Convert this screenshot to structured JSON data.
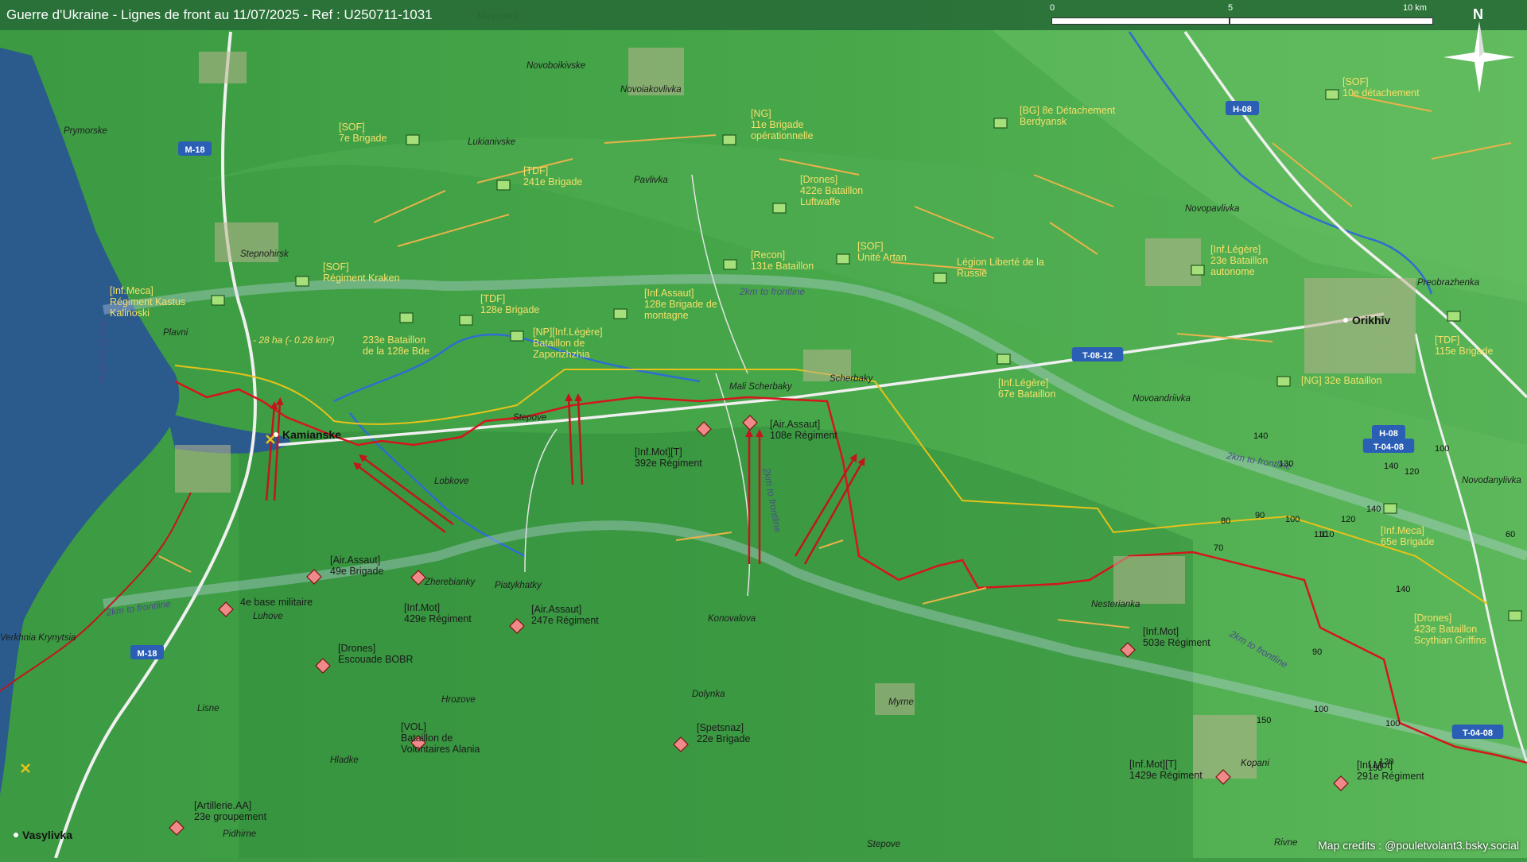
{
  "title": "Guerre d'Ukraine - Lignes de front au 11/07/2025 - Ref : U250711-1031",
  "scale": {
    "labels": [
      "0",
      "5",
      "10 km"
    ]
  },
  "compass": {
    "north": "N"
  },
  "credits": "Map credits : @pouletvolant3.bsky.social",
  "road_labels": [
    {
      "label": "M-18",
      "color": "#2a5fb5"
    },
    {
      "label": "M-18",
      "color": "#2a5fb5"
    },
    {
      "label": "H-08",
      "color": "#2a5fb5"
    },
    {
      "label": "T-08-12",
      "color": "#2a5fb5"
    },
    {
      "label": "H-08",
      "color": "#2a5fb5"
    },
    {
      "label": "T-04-08",
      "color": "#2a5fb5"
    },
    {
      "label": "T-04-08",
      "color": "#2a5fb5"
    }
  ],
  "places": [
    "Novoboikivske",
    "Novoiakovlivka",
    "Prymorske",
    "Lukianivske",
    "Pavlivka",
    "Stepnohirsk",
    "Plavni",
    "Stepove",
    "Mali Scherbaky",
    "Scherbaky",
    "Lobkove",
    "Piatykhatky",
    "Zherebianky",
    "Luhove",
    "Verkhnia Krynytsia",
    "Konovalova",
    "Hrozove",
    "Dolynka",
    "Myrne",
    "Lisne",
    "Hladke",
    "Pidhirne",
    "Novopavlivka",
    "Preobrazhenka",
    "Novoandriivka",
    "Novodanylivka",
    "Nesterianka",
    "Kopani",
    "Rivne",
    "Stepove",
    "Malynivka"
  ],
  "towns": [
    "Kamianske",
    "Orikhiv",
    "Vasylivka"
  ],
  "ukrainian_units": [
    {
      "line1": "[SOF]",
      "line2": "7e Brigade",
      "line3": ""
    },
    {
      "line1": "[TDF]",
      "line2": "241e Brigade",
      "line3": ""
    },
    {
      "line1": "[NG]",
      "line2": "11e Brigade",
      "line3": "opérationnelle"
    },
    {
      "line1": "[BG] 8e Détachement",
      "line2": "Berdyansk",
      "line3": ""
    },
    {
      "line1": "[SOF]",
      "line2": "10e détachement",
      "line3": ""
    },
    {
      "line1": "[Drones]",
      "line2": "422e Bataillon",
      "line3": "Luftwaffe"
    },
    {
      "line1": "[SOF]",
      "line2": "Régiment Kraken",
      "line3": ""
    },
    {
      "line1": "[Recon]",
      "line2": "131e Bataillon",
      "line3": ""
    },
    {
      "line1": "[SOF]",
      "line2": "Unité Artan",
      "line3": ""
    },
    {
      "line1": "Légion Liberté de la",
      "line2": "Russie",
      "line3": ""
    },
    {
      "line1": "[Inf.Meca]",
      "line2": "Régiment Kastus",
      "line3": "Kalinoski"
    },
    {
      "line1": "[TDF]",
      "line2": "128e Brigade",
      "line3": ""
    },
    {
      "line1": "[Inf.Assaut]",
      "line2": "128e Brigade de",
      "line3": "montagne"
    },
    {
      "line1": "233e Bataillon",
      "line2": "de la 128e Bde",
      "line3": ""
    },
    {
      "line1": "[NP][Inf.Légère]",
      "line2": "Bataillon de",
      "line3": "Zaporizhzhia"
    },
    {
      "line1": "[Inf.Légère]",
      "line2": "23e Bataillon",
      "line3": "autonome"
    },
    {
      "line1": "[TDF]",
      "line2": "115e Brigade",
      "line3": ""
    },
    {
      "line1": "[NG] 32e Bataillon",
      "line2": "",
      "line3": ""
    },
    {
      "line1": "[Inf.Légère]",
      "line2": "67e Bataillon",
      "line3": ""
    },
    {
      "line1": "[Inf.Meca]",
      "line2": "65e Brigade",
      "line3": ""
    },
    {
      "line1": "[Drones]",
      "line2": "423e Bataillon",
      "line3": "Scythian Griffins"
    }
  ],
  "russian_units": [
    {
      "line1": "[Air.Assaut]",
      "line2": "108e Régiment",
      "line3": ""
    },
    {
      "line1": "[Inf.Mot][T]",
      "line2": "392e Régiment",
      "line3": ""
    },
    {
      "line1": "[Air.Assaut]",
      "line2": "49e Brigade",
      "line3": ""
    },
    {
      "line1": "4e base militaire",
      "line2": "",
      "line3": ""
    },
    {
      "line1": "[Inf.Mot]",
      "line2": "429e Régiment",
      "line3": ""
    },
    {
      "line1": "[Air.Assaut]",
      "line2": "247e Régiment",
      "line3": ""
    },
    {
      "line1": "[Drones]",
      "line2": "Escouade BOBR",
      "line3": ""
    },
    {
      "line1": "[Inf.Mot]",
      "line2": "503e Régiment",
      "line3": ""
    },
    {
      "line1": "[VOL]",
      "line2": "Bataillon de",
      "line3": "Volontaires Alania"
    },
    {
      "line1": "[Spetsnaz]",
      "line2": "22e Brigade",
      "line3": ""
    },
    {
      "line1": "[Artillerie.AA]",
      "line2": "23e groupement",
      "line3": ""
    },
    {
      "line1": "[Inf.Mot][T]",
      "line2": "1429e Régiment",
      "line3": ""
    },
    {
      "line1": "[Inf.Mot]",
      "line2": "291e Régiment",
      "line3": ""
    }
  ],
  "notes": [
    "- 28 ha (- 0.28 km²)"
  ],
  "frontline_labels": [
    "2km to frontline",
    "2km to frontline",
    "2km to frontline",
    "2km to frontline",
    "2km to frontline",
    "2km to frontline"
  ],
  "elevations": [
    "130",
    "100",
    "120",
    "90",
    "100",
    "110",
    "120",
    "80",
    "110",
    "90",
    "100",
    "140",
    "100",
    "120",
    "150",
    "140",
    "140",
    "140",
    "150",
    "60",
    "70"
  ]
}
